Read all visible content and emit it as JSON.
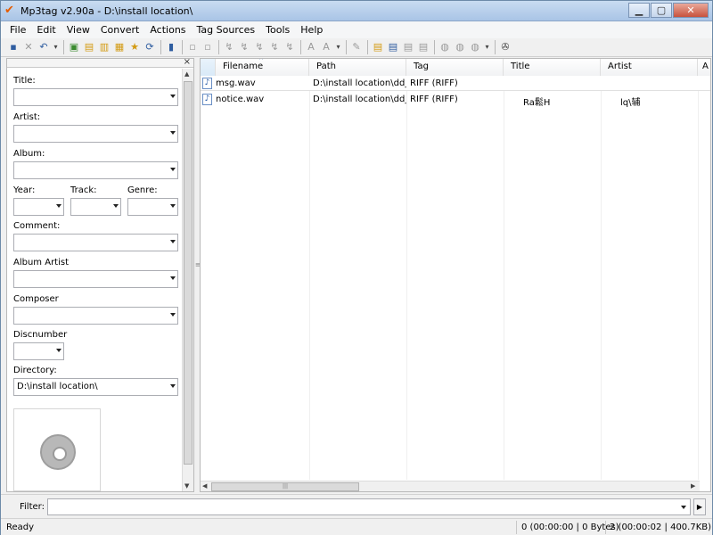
{
  "window": {
    "title": "Mp3tag v2.90a  -  D:\\install location\\",
    "minimize": "▁",
    "maximize": "▢",
    "close": "✕",
    "app_icon": "checkmark-app-icon"
  },
  "menu": [
    "File",
    "Edit",
    "View",
    "Convert",
    "Actions",
    "Tag Sources",
    "Tools",
    "Help"
  ],
  "toolbar": {
    "icons": [
      "save-icon",
      "remove-tag-icon",
      "undo-icon",
      "change-dir-icon",
      "add-dir-icon",
      "favorites-icon",
      "refresh-icon",
      "filter-icon",
      "tag-panel-icon",
      "export-icon",
      "playlist-icon",
      "convert-icon",
      "case-icon",
      "action-icon",
      "options-icon"
    ]
  },
  "tag_panel": {
    "fields": {
      "title": {
        "label": "Title:",
        "value": ""
      },
      "artist": {
        "label": "Artist:",
        "value": ""
      },
      "album": {
        "label": "Album:",
        "value": ""
      },
      "year": {
        "label": "Year:",
        "value": ""
      },
      "track": {
        "label": "Track:",
        "value": ""
      },
      "genre": {
        "label": "Genre:",
        "value": ""
      },
      "comment": {
        "label": "Comment:",
        "value": ""
      },
      "album_artist": {
        "label": "Album Artist",
        "value": ""
      },
      "composer": {
        "label": "Composer",
        "value": ""
      },
      "discnumber": {
        "label": "Discnumber",
        "value": ""
      },
      "directory": {
        "label": "Directory:",
        "value": "D:\\install location\\"
      }
    }
  },
  "file_list": {
    "columns": [
      "Filename",
      "Path",
      "Tag",
      "Title",
      "Artist",
      "A"
    ],
    "rows": [
      {
        "filename": "msg.wav",
        "path": "D:\\install location\\dd_...",
        "tag": "RIFF (RIFF)",
        "title": "",
        "artist": ""
      },
      {
        "filename": "notice.wav",
        "path": "D:\\install location\\dd_...",
        "tag": "RIFF (RIFF)",
        "title": "Ra鬆H",
        "artist": "lq\\辅"
      }
    ]
  },
  "filter": {
    "label": "Filter:",
    "value": ""
  },
  "status": {
    "ready": "Ready",
    "selected": "0 (00:00:00 | 0 Bytes)",
    "total": "2 (00:00:02 | 400.7KB)"
  }
}
